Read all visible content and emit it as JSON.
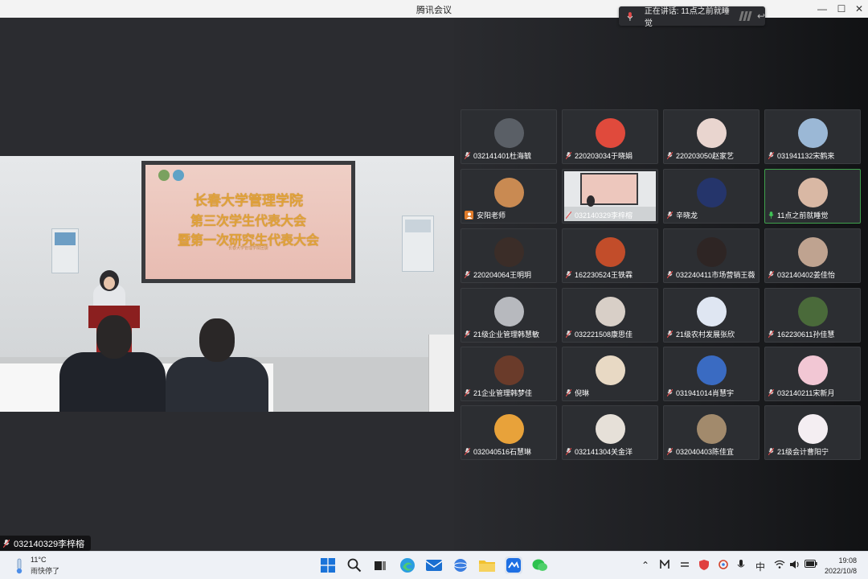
{
  "window": {
    "title": "腾讯会议",
    "minimize_glyph": "—",
    "maximize_glyph": "☐",
    "close_glyph": "✕"
  },
  "speaking_indicator": {
    "text": "正在讲话: 11点之前就睡觉",
    "reply_glyph": "↩"
  },
  "main_video": {
    "participant_name": "032140329李梓榕",
    "banner_lines": [
      "长春大学管理学院",
      "第三次学生代表大会",
      "暨第一次研究生代表大会"
    ],
    "banner_subtitle": "长春大学管理学院团委"
  },
  "participants": [
    {
      "name": "032141401杜海毓",
      "avatar_color": "#5a5f66",
      "badge": "mic"
    },
    {
      "name": "220203034于晓娟",
      "avatar_color": "#e04a3c",
      "badge": "mic"
    },
    {
      "name": "220203050赵家艺",
      "avatar_color": "#e9d5cf",
      "badge": "mic"
    },
    {
      "name": "031941132宋鹤来",
      "avatar_color": "#9bb8d6",
      "badge": "mic"
    },
    {
      "name": "安阳老师",
      "avatar_color": "#c98a52",
      "badge": "person"
    },
    {
      "name": "032140329李梓榕",
      "avatar_color": "#d7dadc",
      "badge": "mic"
    },
    {
      "name": "辛晓龙",
      "avatar_color": "#25356b",
      "badge": "mic"
    },
    {
      "name": "11点之前就睡觉",
      "avatar_color": "#d9b8a4",
      "badge": "speaking"
    },
    {
      "name": "220204064王明玥",
      "avatar_color": "#3b2d28",
      "badge": "mic"
    },
    {
      "name": "162230524王铁霖",
      "avatar_color": "#c24d2a",
      "badge": "mic"
    },
    {
      "name": "032240411市场营销王薇",
      "avatar_color": "#2e2524",
      "badge": "mic"
    },
    {
      "name": "032140402姜佳怡",
      "avatar_color": "#bfa390",
      "badge": "mic"
    },
    {
      "name": "21级企业管理韩慧敏",
      "avatar_color": "#b7b9be",
      "badge": "mic"
    },
    {
      "name": "032221508康思佳",
      "avatar_color": "#d8cfc7",
      "badge": "mic"
    },
    {
      "name": "21级农村发展张欣",
      "avatar_color": "#dfe6f2",
      "badge": "mic"
    },
    {
      "name": "162230611孙佳慧",
      "avatar_color": "#4a6a3a",
      "badge": "mic"
    },
    {
      "name": "21企业管理韩梦佳",
      "avatar_color": "#6a3b2a",
      "badge": "mic"
    },
    {
      "name": "倪琳",
      "avatar_color": "#e8d9c4",
      "badge": "mic"
    },
    {
      "name": "031941014肖慧宇",
      "avatar_color": "#3a6bc2",
      "badge": "mic"
    },
    {
      "name": "032140211宋新月",
      "avatar_color": "#f2c7d4",
      "badge": "mic"
    },
    {
      "name": "032040516石慧琳",
      "avatar_color": "#e8a23a",
      "badge": "mic"
    },
    {
      "name": "032141304关金洋",
      "avatar_color": "#e6e0d8",
      "badge": "mic"
    },
    {
      "name": "032040403陈佳宜",
      "avatar_color": "#a28a6c",
      "badge": "mic"
    },
    {
      "name": "21级会计曹阳宁",
      "avatar_color": "#f4eef2",
      "badge": "mic"
    }
  ],
  "taskbar": {
    "weather_temp": "11°C",
    "weather_desc": "雨快停了",
    "ime": "中",
    "time": "19:08",
    "date": "2022/10/8"
  }
}
